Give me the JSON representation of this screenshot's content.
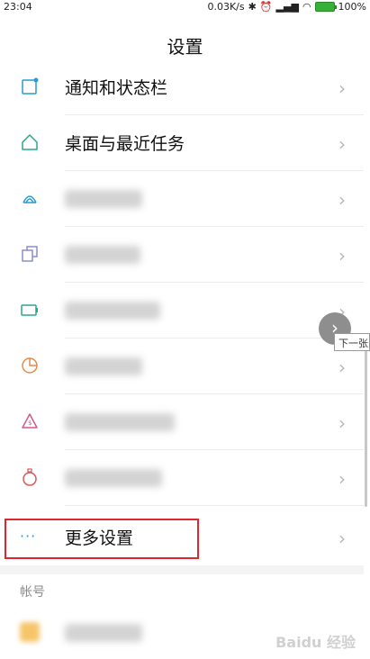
{
  "status_bar": {
    "time": "23:04",
    "network_speed": "0.03K/s",
    "battery_percent": "100%"
  },
  "header": {
    "title": "设置"
  },
  "items": [
    {
      "label": "通知和状态栏",
      "icon": "notification-icon",
      "color": "#2a9bd1"
    },
    {
      "label": "桌面与最近任务",
      "icon": "home-icon",
      "color": "#2aa88a"
    },
    {
      "label": "",
      "icon": "fingerprint-icon",
      "color": "#2a9bd1",
      "blurred": true
    },
    {
      "label": "",
      "icon": "multi-window-icon",
      "color": "#8a8fcf",
      "blurred": true
    },
    {
      "label": "",
      "icon": "battery-icon",
      "color": "#2aa88a",
      "blurred": true
    },
    {
      "label": "",
      "icon": "pie-chart-icon",
      "color": "#e58a4a",
      "blurred": true
    },
    {
      "label": "",
      "icon": "shield-icon",
      "color": "#d25a8a",
      "blurred": true
    },
    {
      "label": "",
      "icon": "timer-icon",
      "color": "#d95a5a",
      "blurred": true
    },
    {
      "label": "更多设置",
      "icon": "more-icon",
      "color": "#2a9bd1"
    }
  ],
  "section": {
    "label": "帐号"
  },
  "overlay": {
    "next_label": "下一张"
  },
  "watermark": "Baidu 经验"
}
